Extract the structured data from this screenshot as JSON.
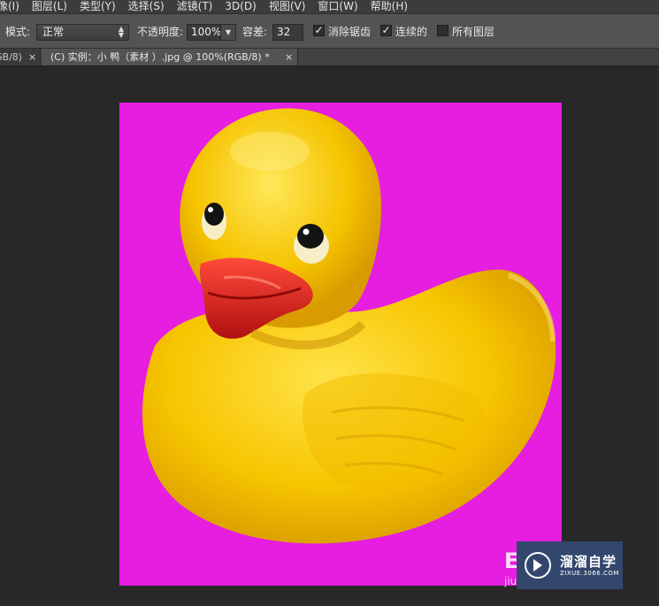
{
  "menu": [
    "像(I)",
    "图层(L)",
    "类型(Y)",
    "选择(S)",
    "滤镜(T)",
    "3D(D)",
    "视图(V)",
    "窗口(W)",
    "帮助(H)"
  ],
  "options": {
    "mode_label": "模式:",
    "mode_value": "正常",
    "opacity_label": "不透明度:",
    "opacity_value": "100%",
    "tolerance_label": "容差:",
    "tolerance_value": "32",
    "antialias_label": "消除锯齿",
    "antialias_checked": true,
    "contiguous_label": "连续的",
    "contiguous_checked": true,
    "all_layers_label": "所有图层",
    "all_layers_checked": false
  },
  "tabs": [
    {
      "label": "GB/8)",
      "close": "×"
    },
    {
      "label": "(C) 实例：小 鸭（素材 ）.jpg @ 100%(RGB/8) *",
      "close": "×"
    }
  ],
  "canvas": {
    "background_color": "#e51ee0",
    "subject": "yellow rubber duck"
  },
  "watermark": {
    "brand": "溜溜自学",
    "url": "ZIXUE.3066.COM",
    "letters": "EU",
    "sub": "jiu"
  },
  "colors": {
    "app_bg": "#282828",
    "menubar": "#3c3c3c",
    "optionsbar": "#535353",
    "tab_active": "#535353",
    "magenta": "#e51ee0",
    "duck_yellow": "#f6c400",
    "beak_red": "#d61c1c"
  }
}
